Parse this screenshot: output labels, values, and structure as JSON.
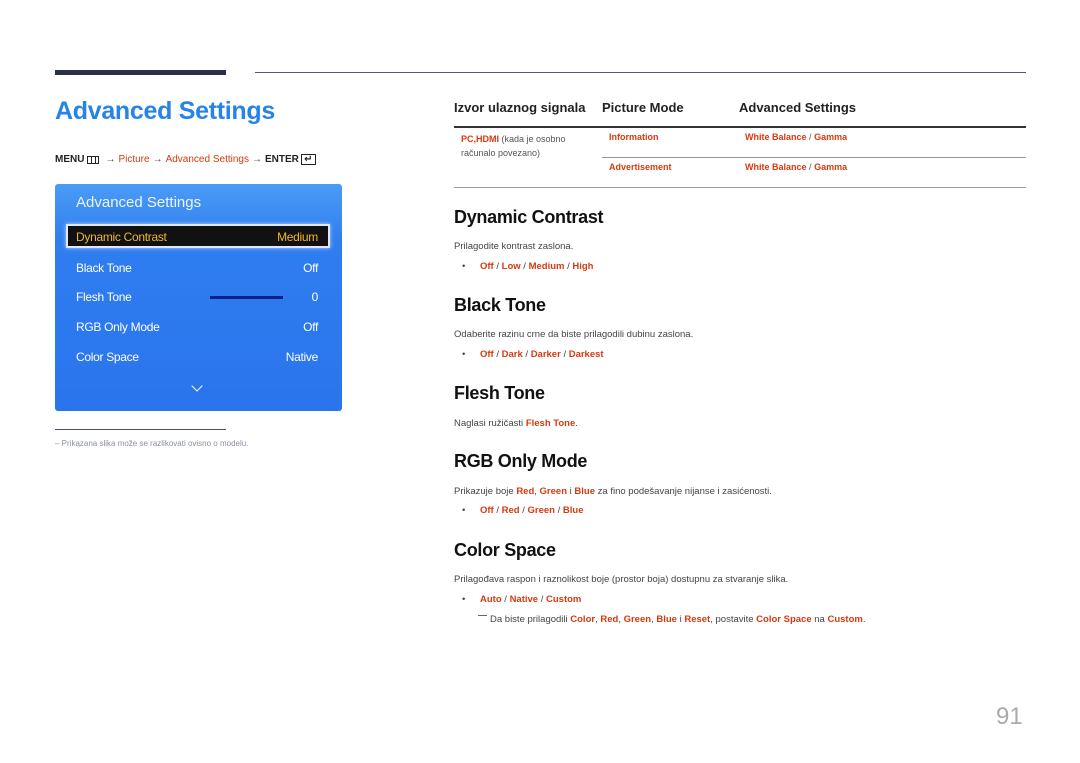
{
  "header": {
    "title": "Advanced Settings",
    "menu_path": {
      "menu": "MENU",
      "arrow": "→",
      "step1": "Picture",
      "step2": "Advanced Settings",
      "enter": "ENTER",
      "menu_icon": "menu-grid-icon",
      "enter_icon": "enter-icon"
    }
  },
  "osd": {
    "title": "Advanced Settings",
    "items": [
      {
        "label": "Dynamic Contrast",
        "value": "Medium",
        "selected": true
      },
      {
        "label": "Black Tone",
        "value": "Off"
      },
      {
        "label": "Flesh Tone",
        "value": "0",
        "slider": true
      },
      {
        "label": "RGB Only Mode",
        "value": "Off"
      },
      {
        "label": "Color Space",
        "value": "Native"
      }
    ],
    "more_icon": "chevron-down-icon",
    "colors": {
      "panel": "#2f7ef0",
      "selected_text": "#f0b729"
    }
  },
  "footnote": "Prikazana slika može se razlikovati ovisno o modelu.",
  "table": {
    "headers": [
      "Izvor ulaznog signala",
      "Picture Mode",
      "Advanced Settings"
    ],
    "source": {
      "red": "PC,HDMI",
      "grey": "(kada je osobno",
      "grey2": "računalo povezano)"
    },
    "rows": [
      {
        "mode": "Information",
        "settings_a": "White Balance",
        "sep": "/",
        "settings_b": "Gamma"
      },
      {
        "mode": "Advertisement",
        "settings_a": "White Balance",
        "sep": "/",
        "settings_b": "Gamma"
      }
    ]
  },
  "sections": {
    "dynamic_contrast": {
      "title": "Dynamic Contrast",
      "desc": "Prilagodite kontrast zaslona.",
      "options": [
        "Off",
        "Low",
        "Medium",
        "High"
      ]
    },
    "black_tone": {
      "title": "Black Tone",
      "desc": "Odaberite razinu crne da biste prilagodili dubinu zaslona.",
      "options": [
        "Off",
        "Dark",
        "Darker",
        "Darkest"
      ]
    },
    "flesh_tone": {
      "title": "Flesh Tone",
      "desc_pre": "Naglasi ružičasti",
      "desc_hl": "Flesh Tone",
      "desc_post": "."
    },
    "rgb_only_mode": {
      "title": "RGB Only Mode",
      "desc_pre": "Prikazuje boje",
      "hl1": "Red",
      "comma": ",",
      "hl2": "Green",
      "and": "i",
      "hl3": "Blue",
      "desc_post": "za fino podešavanje nijanse i zasićenosti.",
      "options": [
        "Off",
        "Red",
        "Green",
        "Blue"
      ]
    },
    "color_space": {
      "title": "Color Space",
      "desc": "Prilagođava raspon i raznolikost boje (prostor boja) dostupnu za stvaranje slika.",
      "options": [
        "Auto",
        "Native",
        "Custom"
      ],
      "note": {
        "pre": "Da biste prilagodili",
        "hl1": "Color",
        "hl2": "Red",
        "hl3": "Green",
        "hl4": "Blue",
        "and": "i",
        "hl5": "Reset",
        "mid": ", postavite",
        "hl6": "Color Space",
        "na": "na",
        "hl7": "Custom",
        "end": "."
      }
    }
  },
  "sep": "/",
  "bullet": "•",
  "page_number": "91"
}
